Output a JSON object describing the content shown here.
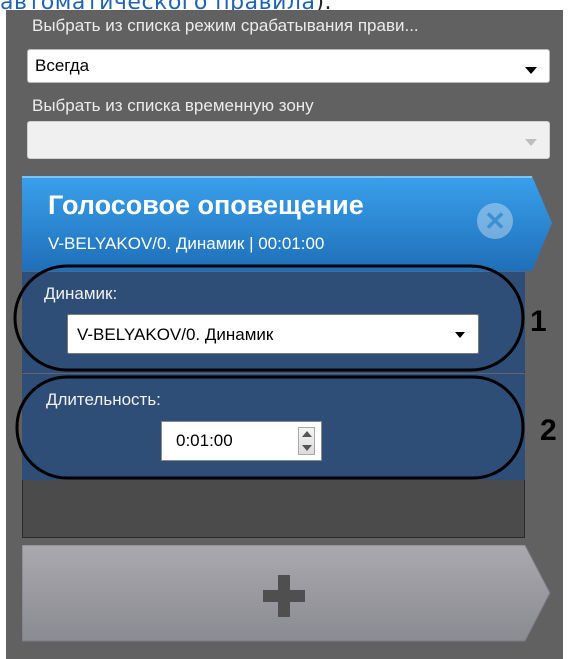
{
  "doc": {
    "link_text": "автоматического правила",
    "link_tail": ")."
  },
  "rule": {
    "mode_label": "Выбрать из списка режим срабатывания прави...",
    "mode_value": "Всегда",
    "tz_label": "Выбрать из списка временную зону",
    "tz_value": ""
  },
  "card": {
    "title": "Голосовое оповещение",
    "subtitle": "V-BELYAKOV/0. Динамик | 00:01:00",
    "close_glyph": "✕",
    "speaker_label": "Динамик:",
    "speaker_value": "V-BELYAKOV/0. Динамик",
    "duration_label": "Длительность:",
    "duration_value": "0:01:00"
  },
  "annotations": [
    "1",
    "2"
  ],
  "colors": {
    "header_blue": "#2f8fd8",
    "section_blue": "#2e4d77",
    "panel_gray": "#616161",
    "outline": "#000000"
  },
  "icons": {
    "close": "close-icon",
    "add": "plus-icon"
  }
}
